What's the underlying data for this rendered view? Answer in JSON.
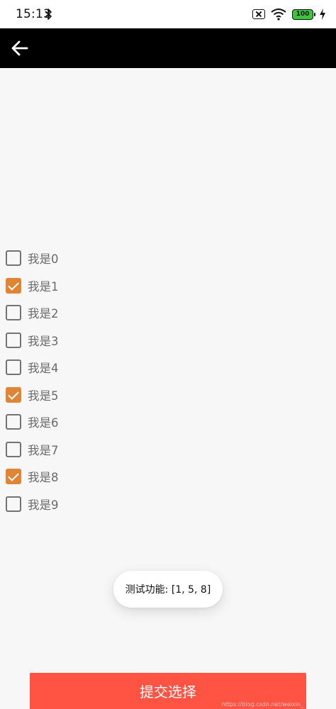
{
  "status_bar": {
    "time": "15:13",
    "battery_level": "100",
    "icons": [
      "bluetooth-icon",
      "sim-blocked-icon",
      "wifi-icon",
      "battery-icon",
      "charging-bolt-icon"
    ]
  },
  "app_bar": {
    "back_icon": "arrow-left-icon",
    "background": "#000000"
  },
  "checkbox_list": {
    "accent_color": "#e08535",
    "items": [
      {
        "label": "我是0",
        "checked": false
      },
      {
        "label": "我是1",
        "checked": true
      },
      {
        "label": "我是2",
        "checked": false
      },
      {
        "label": "我是3",
        "checked": false
      },
      {
        "label": "我是4",
        "checked": false
      },
      {
        "label": "我是5",
        "checked": true
      },
      {
        "label": "我是6",
        "checked": false
      },
      {
        "label": "我是7",
        "checked": false
      },
      {
        "label": "我是8",
        "checked": true
      },
      {
        "label": "我是9",
        "checked": false
      }
    ]
  },
  "toast": {
    "text": "测试功能: [1, 5, 8]"
  },
  "submit_button": {
    "label": "提交选择",
    "color": "#ff5343"
  },
  "watermark": {
    "text": "https://blog.csdn.net/weixin_"
  }
}
